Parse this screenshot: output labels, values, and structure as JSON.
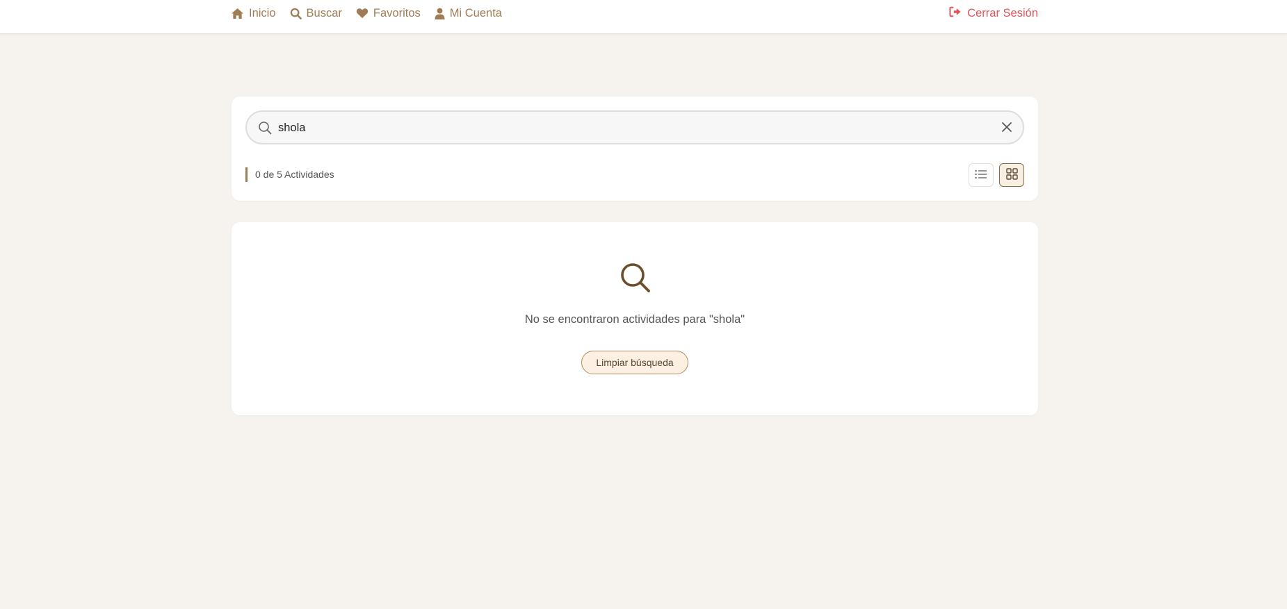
{
  "nav": {
    "items": [
      {
        "label": "Inicio",
        "icon": "home-icon"
      },
      {
        "label": "Buscar",
        "icon": "search-icon"
      },
      {
        "label": "Favoritos",
        "icon": "heart-icon"
      },
      {
        "label": "Mi Cuenta",
        "icon": "user-icon"
      }
    ],
    "logout_label": "Cerrar Sesión"
  },
  "search": {
    "value": "shola",
    "count_text": "0 de 5 Actividades",
    "active_view": "grid"
  },
  "results": {
    "empty_message": "No se encontraron actividades para \"shola\"",
    "clear_button_label": "Limpiar búsqueda"
  },
  "colors": {
    "accent": "#a07c55",
    "logout": "#e0555c",
    "background": "#f6f3ee"
  }
}
